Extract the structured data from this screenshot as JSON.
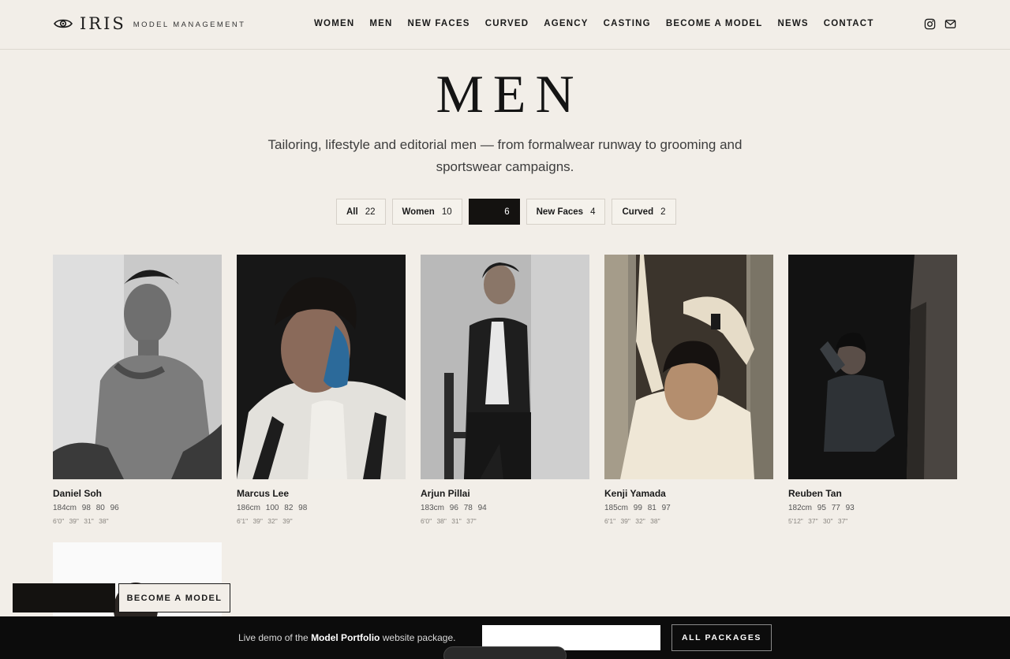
{
  "header": {
    "logo": "IRIS",
    "logo_sub": "MODEL MANAGEMENT",
    "nav": [
      "WOMEN",
      "MEN",
      "NEW FACES",
      "CURVED",
      "AGENCY",
      "CASTING",
      "BECOME A MODEL",
      "NEWS",
      "CONTACT"
    ],
    "icons": [
      "instagram-icon",
      "mail-icon"
    ]
  },
  "hero": {
    "title": "MEN",
    "intro": "Tailoring, lifestyle and editorial men — from formalwear runway to grooming and sportswear campaigns."
  },
  "filters": [
    {
      "label": "All",
      "count": "22"
    },
    {
      "label": "Women",
      "count": "10"
    },
    {
      "label": "",
      "count": "6"
    },
    {
      "label": "New Faces",
      "count": "4"
    },
    {
      "label": "Curved",
      "count": "2"
    }
  ],
  "models": [
    {
      "name": "Daniel Soh",
      "metric": "184cm 98 80 96",
      "imperial": "6'0\" 39\" 31\" 38\""
    },
    {
      "name": "Marcus Lee",
      "metric": "186cm 100 82 98",
      "imperial": "6'1\" 39\" 32\" 39\""
    },
    {
      "name": "Arjun Pillai",
      "metric": "183cm 96 78 94",
      "imperial": "6'0\" 38\" 31\" 37\""
    },
    {
      "name": "Kenji Yamada",
      "metric": "185cm 99 81 97",
      "imperial": "6'1\" 39\" 32\" 38\""
    },
    {
      "name": "Reuben Tan",
      "metric": "182cm 95 77 93",
      "imperial": "5'12\" 37\" 30\" 37\""
    }
  ],
  "floating": {
    "become_label": "BECOME A MODEL"
  },
  "demo_bar": {
    "text_before": "Live demo of the ",
    "text_bold": "Model Portfolio",
    "text_after": " website package.",
    "button": "ALL PACKAGES"
  },
  "colors": {
    "background": "#f2eee8",
    "dark": "#141210",
    "bar": "#0c0c0c"
  }
}
